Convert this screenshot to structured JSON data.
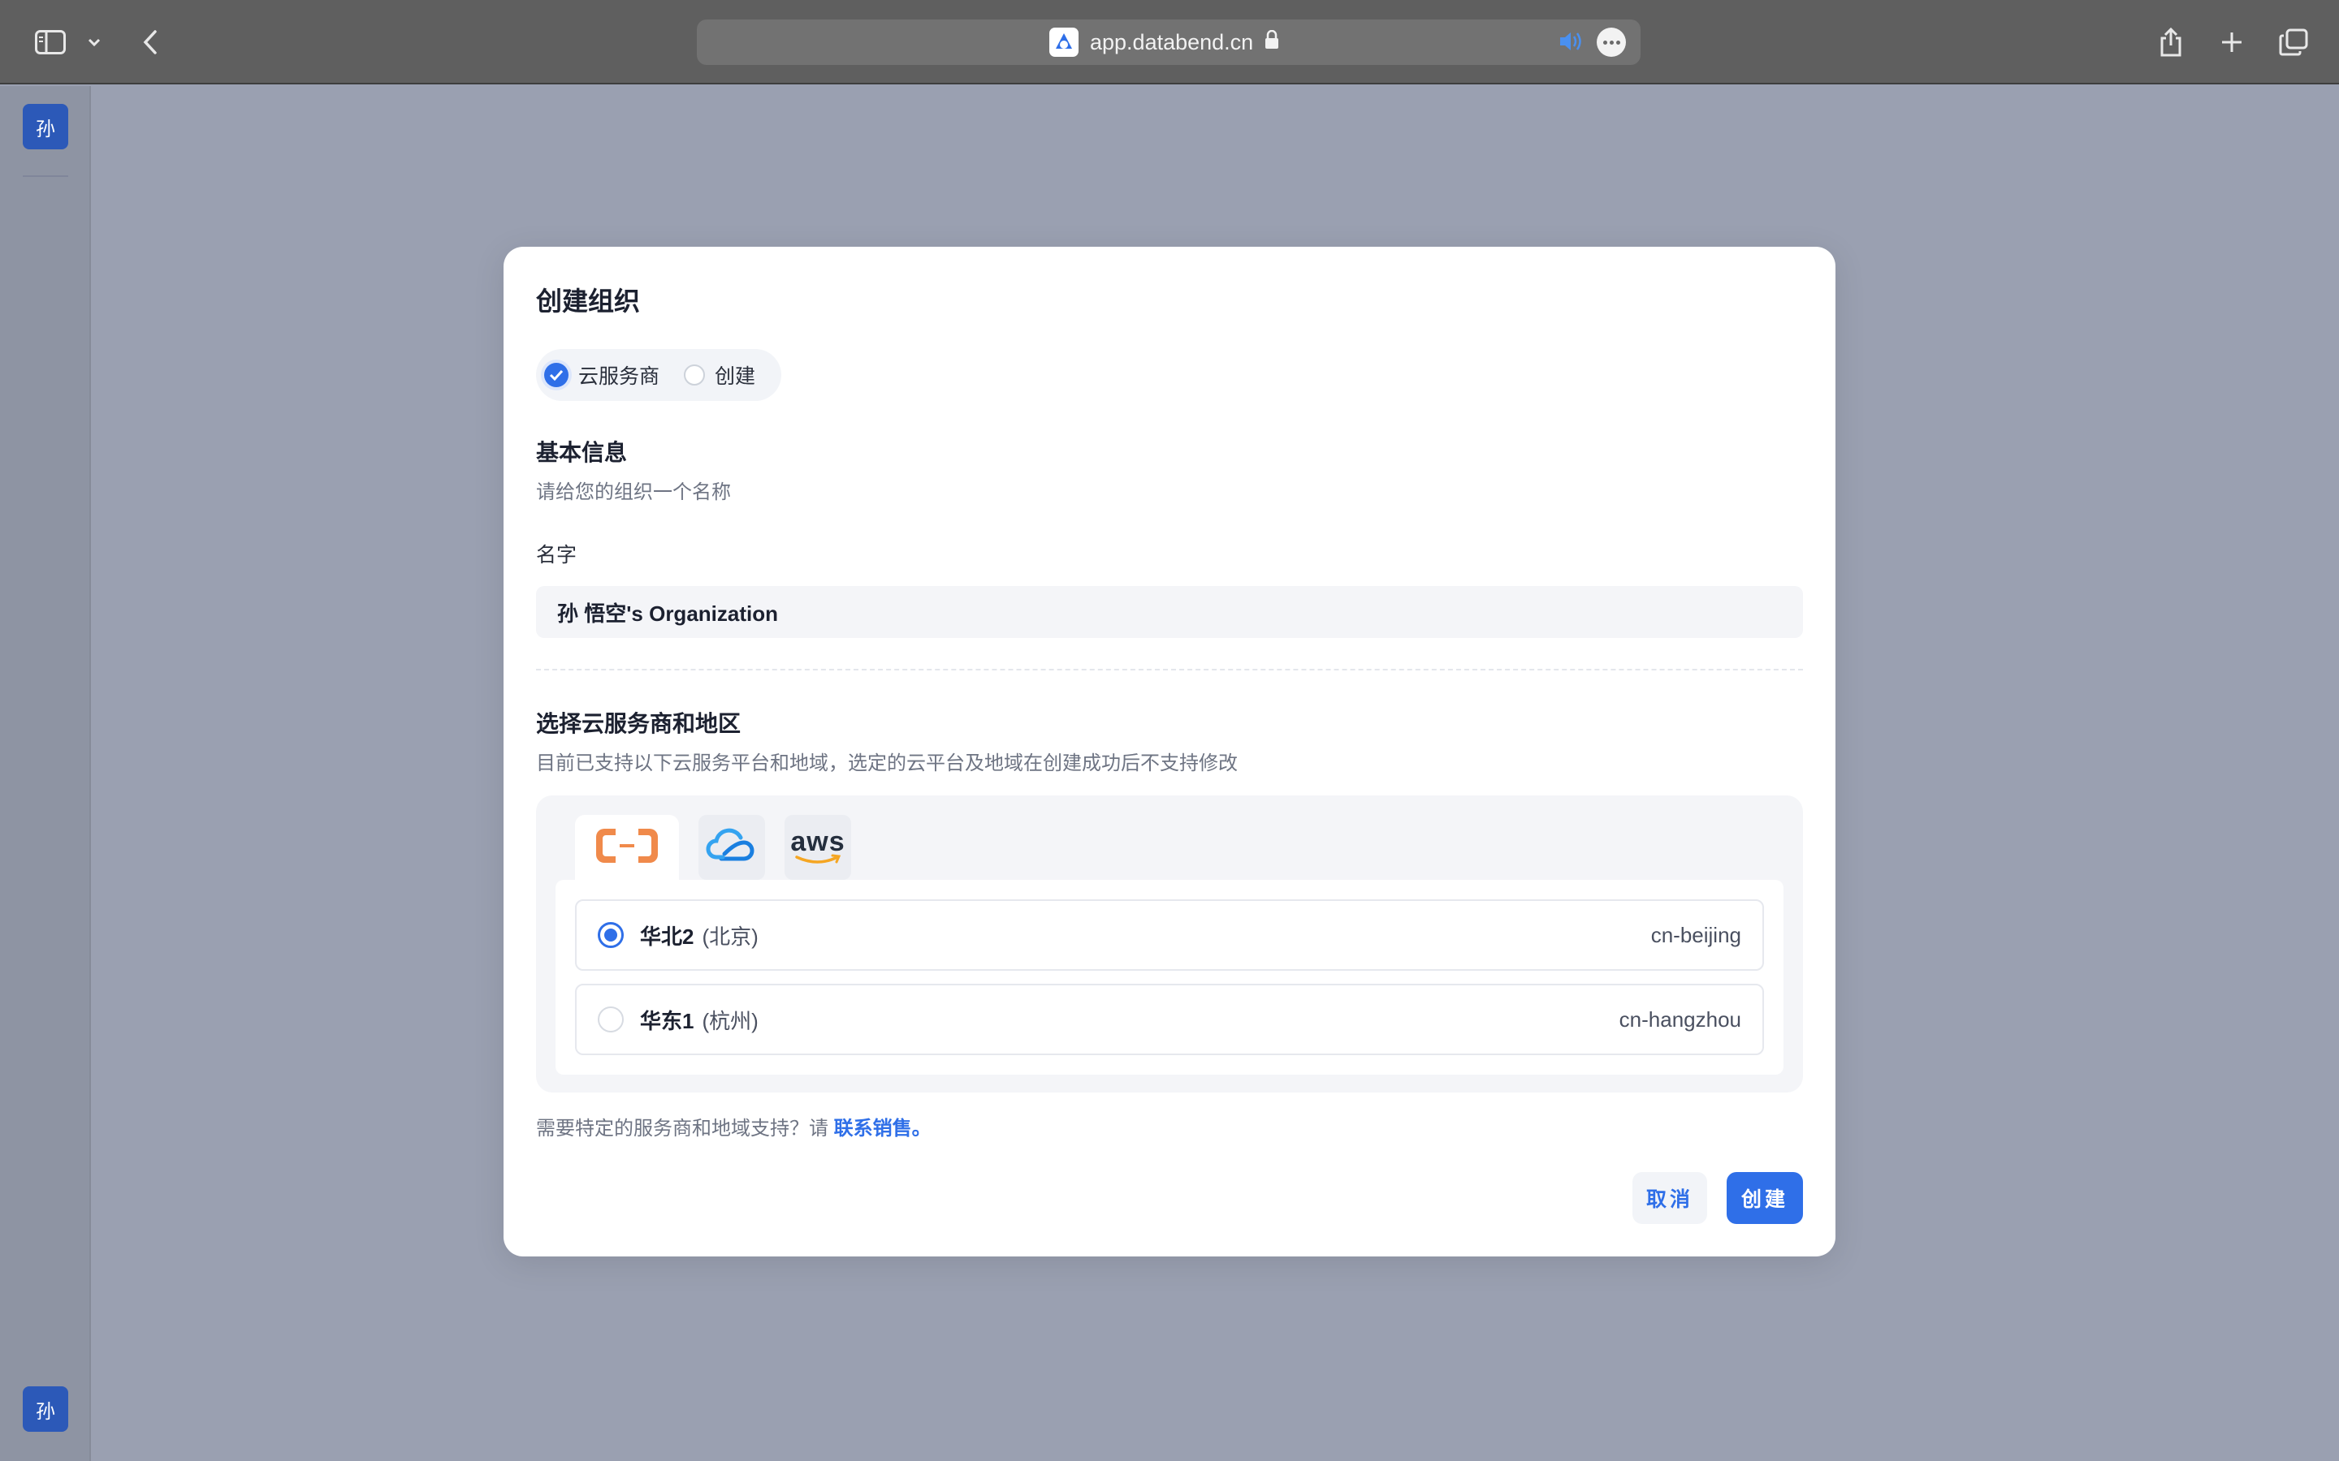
{
  "browser": {
    "url": "app.databend.cn",
    "icons": [
      "sidebar-toggle-icon",
      "chevron-down-icon",
      "back-icon",
      "lock-icon",
      "speaker-icon",
      "more-icon",
      "share-icon",
      "plus-icon",
      "tabs-icon"
    ]
  },
  "sidebar": {
    "avatar_top": "孙",
    "avatar_bottom": "孙"
  },
  "modal": {
    "title": "创建组织",
    "mode_options": [
      {
        "label": "云服务商",
        "selected": true
      },
      {
        "label": "创建",
        "selected": false
      }
    ],
    "basic": {
      "title": "基本信息",
      "desc": "请给您的组织一个名称",
      "name_label": "名字",
      "name_value": "孙 悟空's Organization"
    },
    "cloud": {
      "title": "选择云服务商和地区",
      "desc": "目前已支持以下云服务平台和地域，选定的云平台及地域在创建成功后不支持修改",
      "providers": [
        {
          "icon": "alibaba-cloud-icon",
          "active": true
        },
        {
          "icon": "tencent-cloud-icon",
          "active": false
        },
        {
          "icon": "aws-icon",
          "label": "aws",
          "active": false
        }
      ],
      "regions": [
        {
          "name": "华北2",
          "city": "(北京)",
          "code": "cn-beijing",
          "selected": true
        },
        {
          "name": "华东1",
          "city": "(杭州)",
          "code": "cn-hangzhou",
          "selected": false
        }
      ]
    },
    "help_text": "需要特定的服务商和地域支持？请",
    "help_link": "联系销售。",
    "cancel_label": "取消",
    "create_label": "创建"
  },
  "colors": {
    "accent": "#2f6fe8",
    "overlay": "#9aa0b1",
    "avatar": "#2c59b8",
    "alibaba": "#f08a4b"
  }
}
